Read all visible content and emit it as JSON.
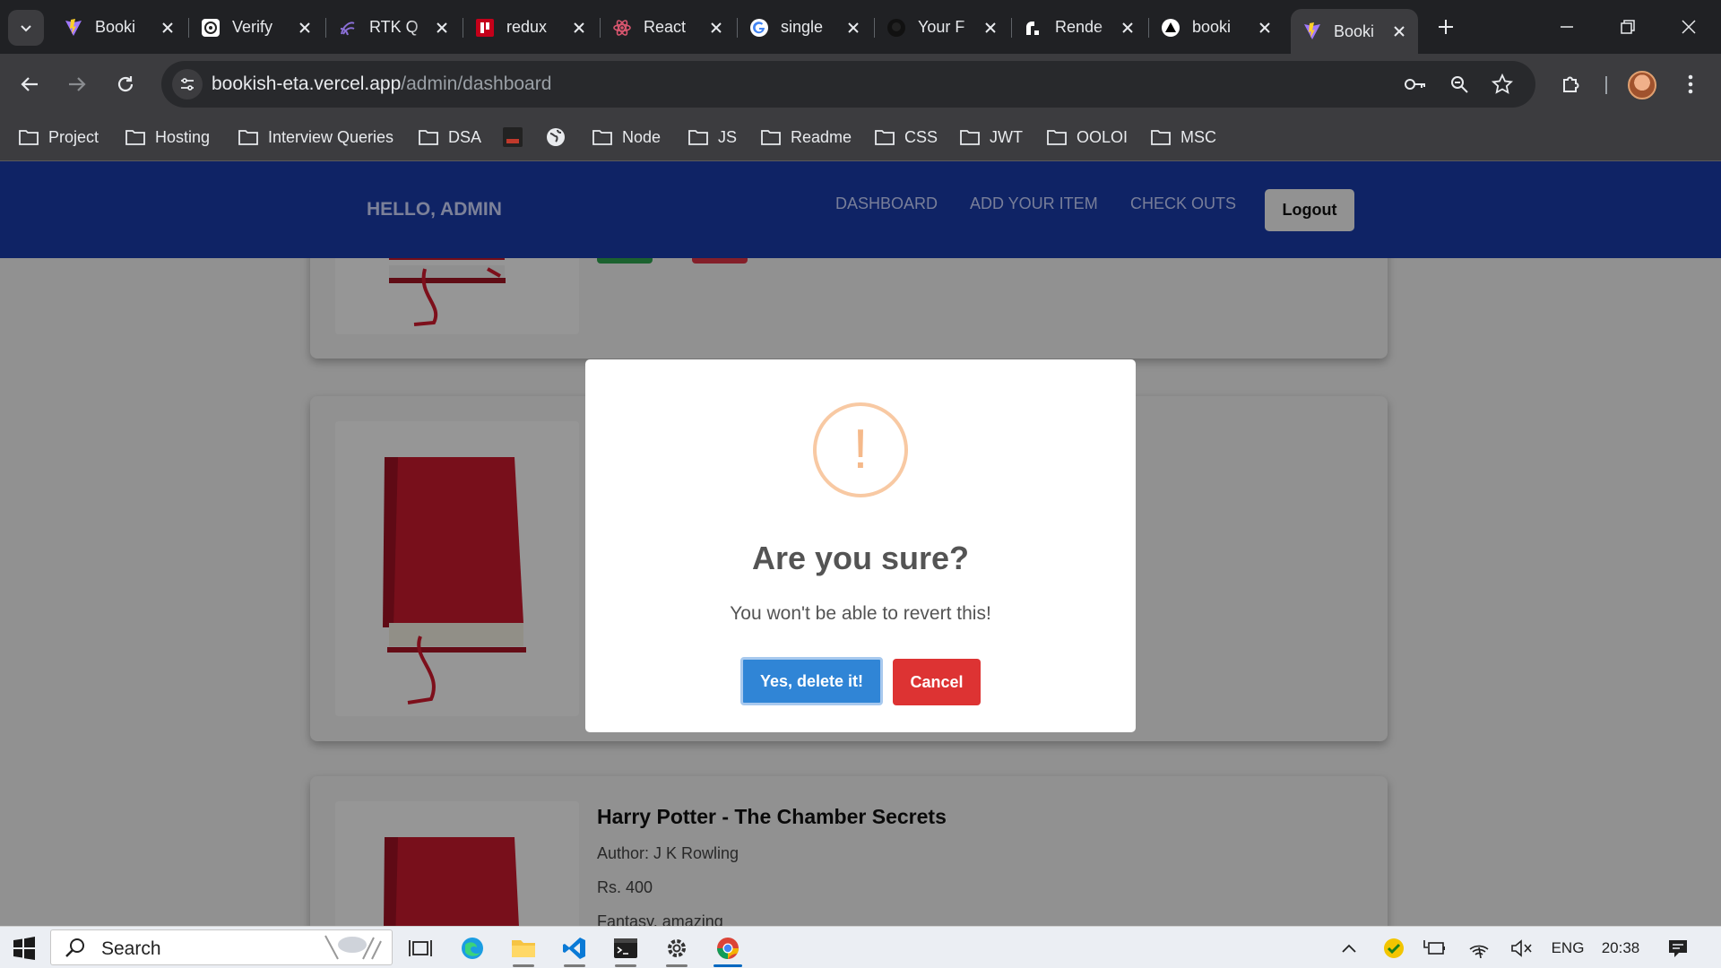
{
  "browser": {
    "tabs": [
      {
        "label": "Booki",
        "icon": "vite-icon"
      },
      {
        "label": "Verify",
        "icon": "openai-icon"
      },
      {
        "label": "RTK Q",
        "icon": "rtk-icon"
      },
      {
        "label": "redux",
        "icon": "netlify-icon"
      },
      {
        "label": "React",
        "icon": "react-icon"
      },
      {
        "label": "single",
        "icon": "google-icon"
      },
      {
        "label": "Your F",
        "icon": "github-icon"
      },
      {
        "label": "Rende",
        "icon": "render-icon"
      },
      {
        "label": "booki",
        "icon": "vercel-icon"
      },
      {
        "label": "Booki",
        "icon": "vite-icon",
        "active": true
      }
    ],
    "url_host": "bookish-eta.vercel.app",
    "url_path": "/admin/dashboard",
    "bookmarks": [
      {
        "label": "Project",
        "type": "folder"
      },
      {
        "label": "Hosting",
        "type": "folder"
      },
      {
        "label": "Interview Queries",
        "type": "folder"
      },
      {
        "label": "DSA",
        "type": "folder"
      },
      {
        "label": "",
        "type": "site-icon"
      },
      {
        "label": "",
        "type": "globe-icon"
      },
      {
        "label": "Node",
        "type": "folder"
      },
      {
        "label": "JS",
        "type": "folder"
      },
      {
        "label": "Readme",
        "type": "folder"
      },
      {
        "label": "CSS",
        "type": "folder"
      },
      {
        "label": "JWT",
        "type": "folder"
      },
      {
        "label": "OOLOI",
        "type": "folder"
      },
      {
        "label": "MSC",
        "type": "folder"
      }
    ]
  },
  "navbar": {
    "greeting": "HELLO, ADMIN",
    "links": [
      "DASHBOARD",
      "ADD YOUR ITEM",
      "CHECK OUTS"
    ],
    "logout_label": "Logout",
    "background": "#1a3ba8"
  },
  "books": [
    {
      "title": "",
      "author": "",
      "price": "",
      "tags": ""
    },
    {
      "title": "",
      "author": "",
      "price": "",
      "tags": ""
    },
    {
      "title": "Harry Potter - The Chamber Secrets",
      "author": "Author: J K Rowling",
      "price": "Rs. 400",
      "tags": "Fantasy, amazing"
    }
  ],
  "dialog": {
    "icon": "warning-icon",
    "icon_glyph": "!",
    "title": "Are you sure?",
    "text": "You won't be able to revert this!",
    "confirm_label": "Yes, delete it!",
    "cancel_label": "Cancel",
    "confirm_color": "#3085d6",
    "cancel_color": "#dd3333"
  },
  "taskbar": {
    "search_label": "Search",
    "tray_language": "ENG",
    "tray_time": "20:38"
  }
}
